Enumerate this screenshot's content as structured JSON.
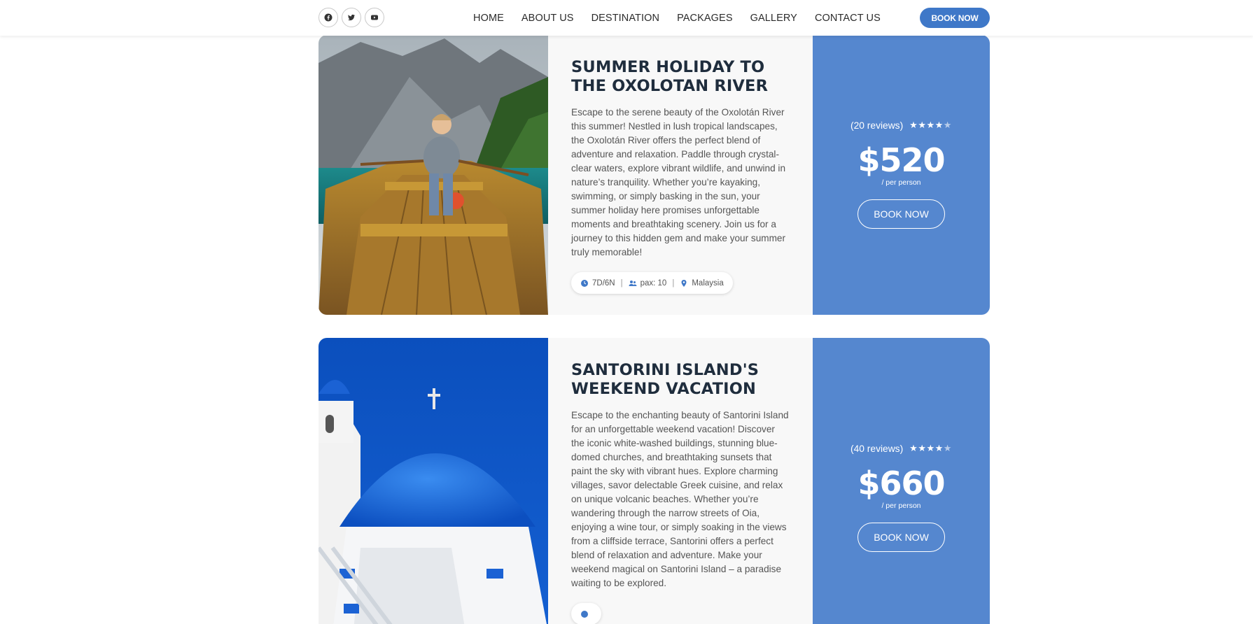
{
  "header": {
    "socials": [
      {
        "icon": "facebook-icon"
      },
      {
        "icon": "twitter-icon"
      },
      {
        "icon": "youtube-icon"
      }
    ],
    "nav": [
      "HOME",
      "ABOUT US",
      "DESTINATION",
      "PACKAGES",
      "GALLERY",
      "CONTACT US"
    ],
    "book_label": "BOOK NOW"
  },
  "packages": [
    {
      "title": "SUMMER HOLIDAY TO THE OXOLOTAN RIVER",
      "description": "Escape to the serene beauty of the Oxolotán River this summer! Nestled in lush tropical landscapes, the Oxolotán River offers the perfect blend of adventure and relaxation. Paddle through crystal-clear waters, explore vibrant wildlife, and unwind in nature’s tranquility. Whether you’re kayaking, swimming, or simply basking in the sun, your summer holiday here promises unforgettable moments and breathtaking scenery. Join us for a journey to this hidden gem and make your summer truly memorable!",
      "duration": "7D/6N",
      "pax": "pax: 10",
      "location": "Malaysia",
      "reviews": "(20 reviews)",
      "rating": 4,
      "price": "$520",
      "per": "/ per person",
      "book_label": "BOOK NOW"
    },
    {
      "title": "SANTORINI ISLAND'S WEEKEND VACATION",
      "description": "Escape to the enchanting beauty of Santorini Island for an unforgettable weekend vacation! Discover the iconic white-washed buildings, stunning blue-domed churches, and breathtaking sunsets that paint the sky with vibrant hues. Explore charming villages, savor delectable Greek cuisine, and relax on unique volcanic beaches. Whether you’re wandering through the narrow streets of Oia, enjoying a wine tour, or simply soaking in the views from a cliffside terrace, Santorini offers a perfect blend of relaxation and adventure. Make your weekend magical on Santorini Island – a paradise waiting to be explored.",
      "reviews": "(40 reviews)",
      "rating": 4,
      "price": "$660",
      "per": "/ per person",
      "book_label": "BOOK NOW"
    }
  ],
  "colors": {
    "accent": "#3f78c8",
    "price_panel": "#5587cf",
    "title": "#1f2d3d"
  }
}
